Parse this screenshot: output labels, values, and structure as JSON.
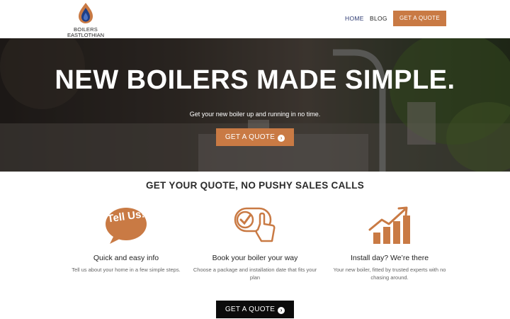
{
  "logo": {
    "line1": "BOILERS",
    "line2": "EASTLOTHIAN"
  },
  "nav": {
    "home": "HOME",
    "blog": "BLOG",
    "quote": "GET A QUOTE"
  },
  "hero": {
    "title": "NEW BOILERS MADE SIMPLE.",
    "subtitle": "Get your new boiler up and running in no time.",
    "button": "GET A QUOTE"
  },
  "section": {
    "title": "GET YOUR QUOTE, NO PUSHY SALES CALLS"
  },
  "features": [
    {
      "icon": "tell-us-speech-bubble-icon",
      "icon_text": "Tell Us!",
      "title": "Quick and easy info",
      "desc": "Tell us about your home in a few simple steps."
    },
    {
      "icon": "tap-checkmark-icon",
      "title": "Book your boiler your way",
      "desc": "Choose a package and installation date that fits your plan"
    },
    {
      "icon": "growth-chart-icon",
      "title": "Install day? We’re there",
      "desc": "Your new boiler, fitted by trusted experts with no chasing around."
    }
  ],
  "cta": {
    "button": "GET A QUOTE"
  },
  "colors": {
    "accent": "#c97a44",
    "nav_active": "#2d3a72",
    "dark_button": "#0b0b0b"
  }
}
